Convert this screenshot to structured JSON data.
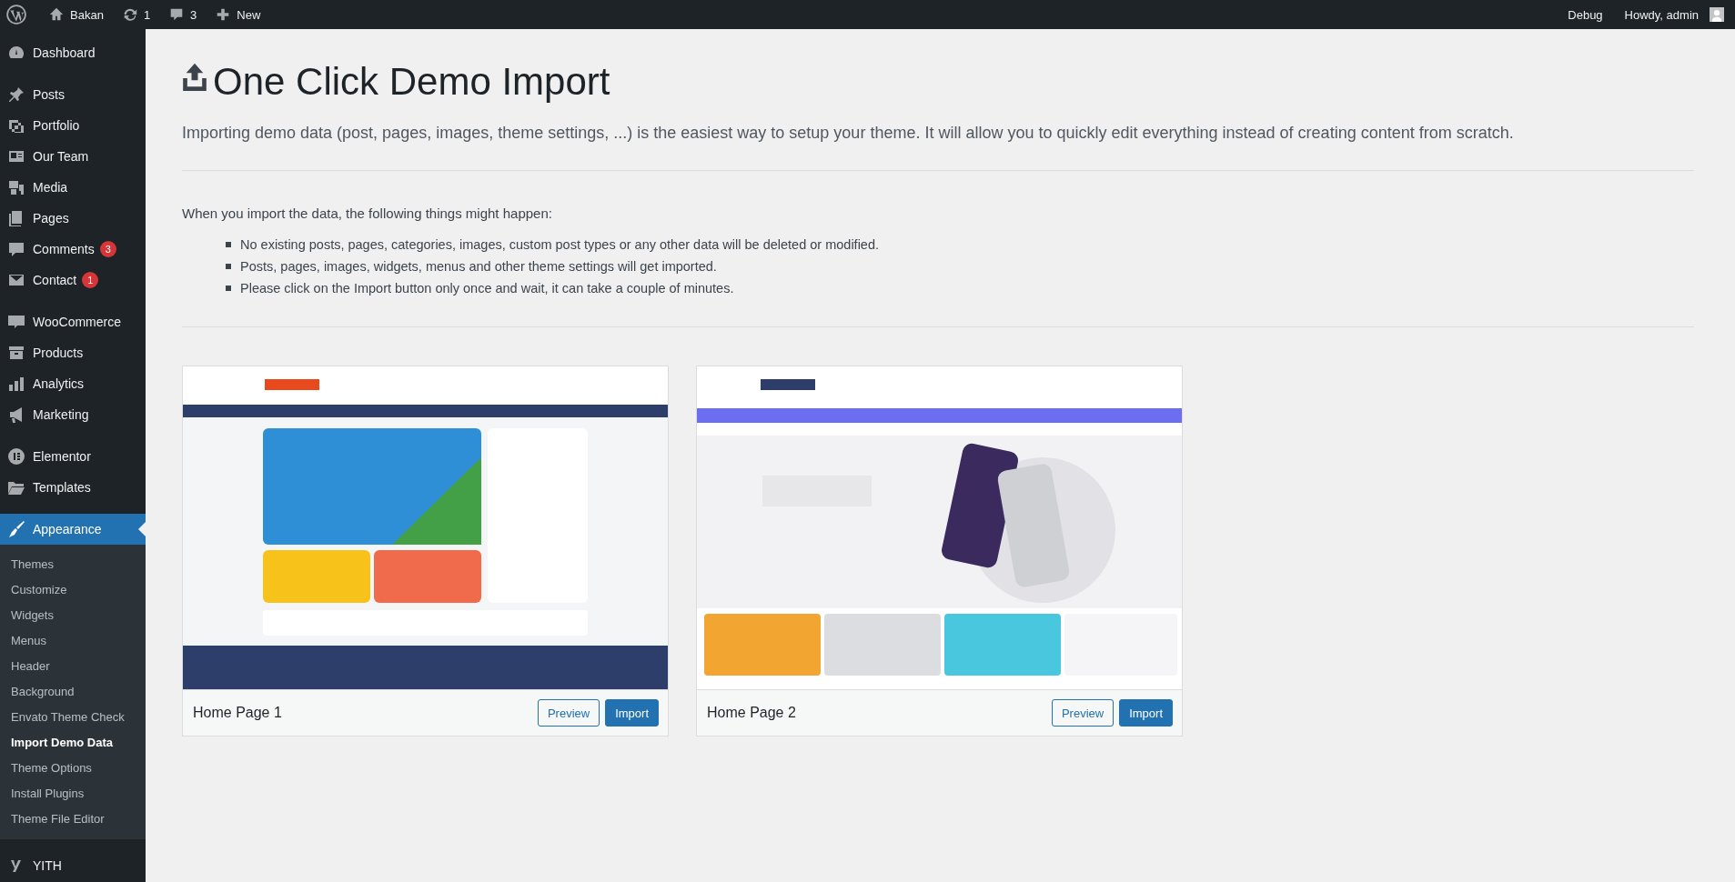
{
  "admin_bar": {
    "left": [
      {
        "kind": "logo"
      },
      {
        "kind": "site",
        "label": "Bakan"
      },
      {
        "kind": "updates",
        "label": "1"
      },
      {
        "kind": "comments",
        "label": "3"
      },
      {
        "kind": "new",
        "label": "New"
      }
    ],
    "right": [
      {
        "label": "Debug"
      },
      {
        "label": "Howdy, admin"
      }
    ]
  },
  "sidebar": {
    "groups": [
      [
        {
          "label": "Dashboard",
          "selected": false
        }
      ],
      [
        {
          "label": "Posts",
          "selected": false
        },
        {
          "label": "Portfolio",
          "selected": false
        },
        {
          "label": "Our Team",
          "selected": false
        },
        {
          "label": "Media",
          "selected": false
        },
        {
          "label": "Pages",
          "selected": false
        },
        {
          "label": "Comments",
          "selected": false,
          "badge": "3"
        },
        {
          "label": "Contact",
          "selected": false,
          "badge": "1"
        }
      ],
      [
        {
          "label": "WooCommerce",
          "selected": false
        },
        {
          "label": "Products",
          "selected": false
        },
        {
          "label": "Analytics",
          "selected": false
        },
        {
          "label": "Marketing",
          "selected": false
        }
      ],
      [
        {
          "label": "Elementor",
          "selected": false
        },
        {
          "label": "Templates",
          "selected": false
        }
      ],
      [
        {
          "label": "Appearance",
          "selected": true,
          "children": [
            {
              "label": "Themes",
              "selected": false
            },
            {
              "label": "Customize",
              "selected": false
            },
            {
              "label": "Widgets",
              "selected": false
            },
            {
              "label": "Menus",
              "selected": false
            },
            {
              "label": "Header",
              "selected": false
            },
            {
              "label": "Background",
              "selected": false
            },
            {
              "label": "Envato Theme Check",
              "selected": false
            },
            {
              "label": "Import Demo Data",
              "selected": true
            },
            {
              "label": "Theme Options",
              "selected": false
            },
            {
              "label": "Install Plugins",
              "selected": false
            },
            {
              "label": "Theme File Editor",
              "selected": false
            }
          ]
        }
      ],
      [
        {
          "label": "YITH",
          "selected": false
        }
      ]
    ]
  },
  "page": {
    "title": "One Click Demo Import",
    "intro": "Importing demo data (post, pages, images, theme settings, ...) is the easiest way to setup your theme. It will allow you to quickly edit everything instead of creating content from scratch.",
    "notice_lead": "When you import the data, the following things might happen:",
    "notice_items": [
      "No existing posts, pages, categories, images, custom post types or any other data will be deleted or modified.",
      "Posts, pages, images, widgets, menus and other theme settings will get imported.",
      "Please click on the Import button only once and wait, it can take a couple of minutes."
    ]
  },
  "demos": [
    {
      "name": "Home Page 1",
      "preview": "Preview",
      "import": "Import"
    },
    {
      "name": "Home Page 2",
      "preview": "Preview",
      "import": "Import"
    }
  ]
}
